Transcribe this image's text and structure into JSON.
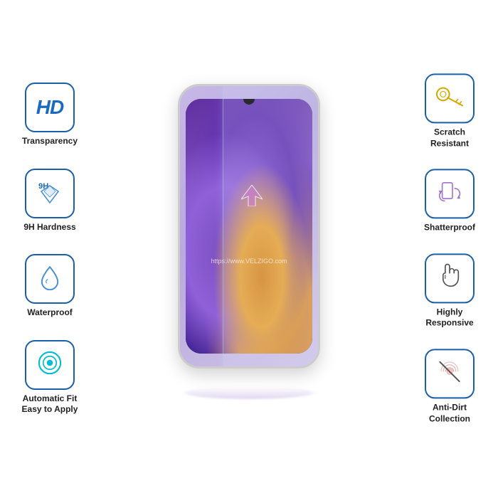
{
  "features": {
    "left": [
      {
        "id": "hd-transparency",
        "label": "Transparency",
        "icon": "hd"
      },
      {
        "id": "9h-hardness",
        "label": "9H Hardness",
        "icon": "diamond"
      },
      {
        "id": "waterproof",
        "label": "Waterproof",
        "icon": "water"
      },
      {
        "id": "auto-fit",
        "label": "Automatic Fit\nEasy to Apply",
        "icon": "circle"
      }
    ],
    "right": [
      {
        "id": "scratch-resistant",
        "label": "Scratch\nResistant",
        "icon": "key"
      },
      {
        "id": "shatterproof",
        "label": "Shatterproof",
        "icon": "rotate"
      },
      {
        "id": "responsive",
        "label": "Highly\nResponsive",
        "icon": "touch"
      },
      {
        "id": "anti-dirt",
        "label": "Anti-Dirt\nCollection",
        "icon": "nodirt"
      }
    ]
  },
  "watermark": "https://www.VELZIGO.com",
  "brand": "VELZIGO",
  "hardness_label": "9H"
}
